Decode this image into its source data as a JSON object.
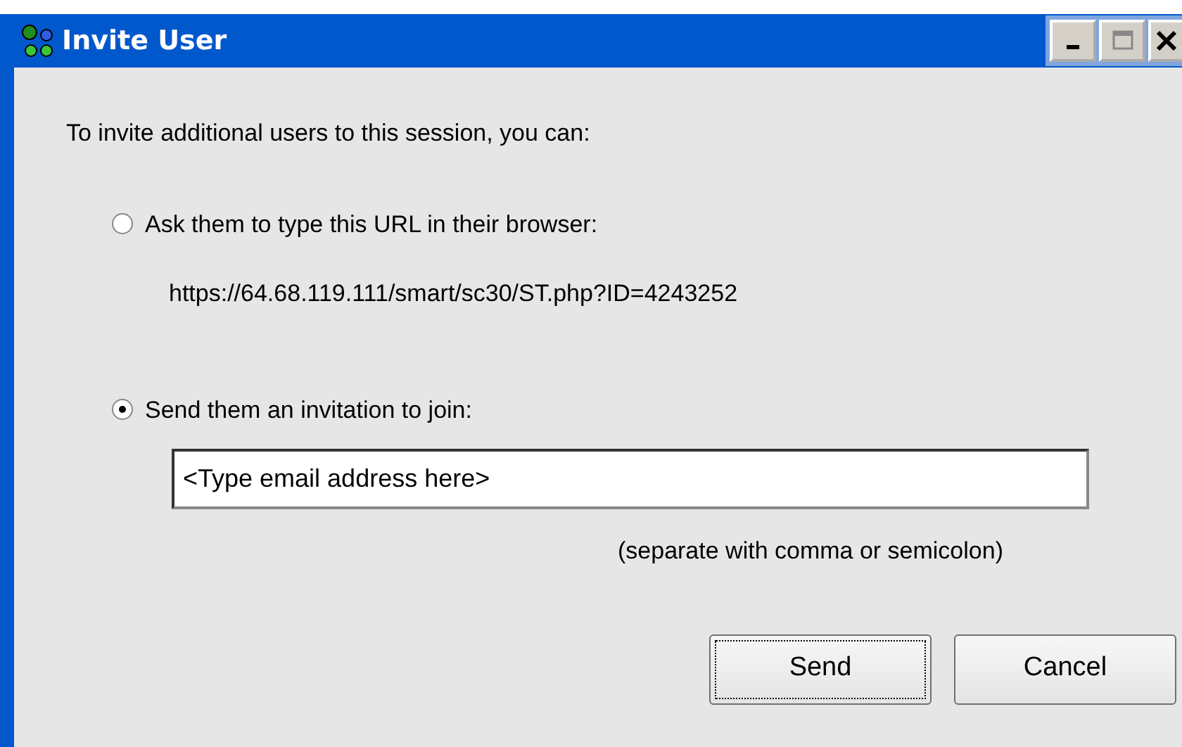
{
  "window": {
    "title": "Invite User"
  },
  "intro": "To invite additional users to this session, you can:",
  "options": [
    {
      "kind": "url",
      "label": "Ask them to type this URL in their browser:",
      "selected": false,
      "url": "https://64.68.119.111/smart/sc30/ST.php?ID=4243252"
    },
    {
      "kind": "email",
      "label": "Send them an invitation to join:",
      "selected": true,
      "value": "<Type email address here>",
      "hint": "(separate with comma or semicolon)"
    }
  ],
  "buttons": [
    {
      "label": "Send",
      "focused": true
    },
    {
      "label": "Cancel",
      "focused": false
    }
  ]
}
